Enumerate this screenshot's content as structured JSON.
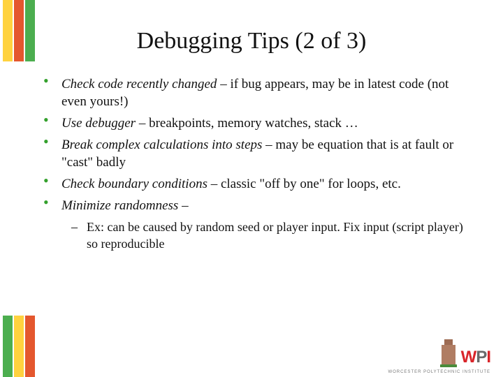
{
  "title": "Debugging Tips (2 of 3)",
  "stripes": {
    "c1": "#ffd23f",
    "c2": "#e4572e",
    "c3": "#4cae4f"
  },
  "bullets": [
    {
      "lead": "Check code recently changed",
      "rest": " – if bug appears, may be in latest code (not even yours!)"
    },
    {
      "lead": "Use debugger",
      "rest": " – breakpoints, memory watches, stack …"
    },
    {
      "lead": "Break complex calculations into steps",
      "rest": " – may be equation that is at fault or \"cast\" badly"
    },
    {
      "lead": "Check boundary conditions",
      "rest": " – classic \"off by one\" for loops, etc."
    },
    {
      "lead": "Minimize randomness",
      "rest": " –",
      "sub": "Ex: can be caused by random seed or player input. Fix input (script player) so reproducible"
    }
  ],
  "logo": {
    "text": "WPI",
    "inst": "WORCESTER POLYTECHNIC INSTITUTE"
  }
}
